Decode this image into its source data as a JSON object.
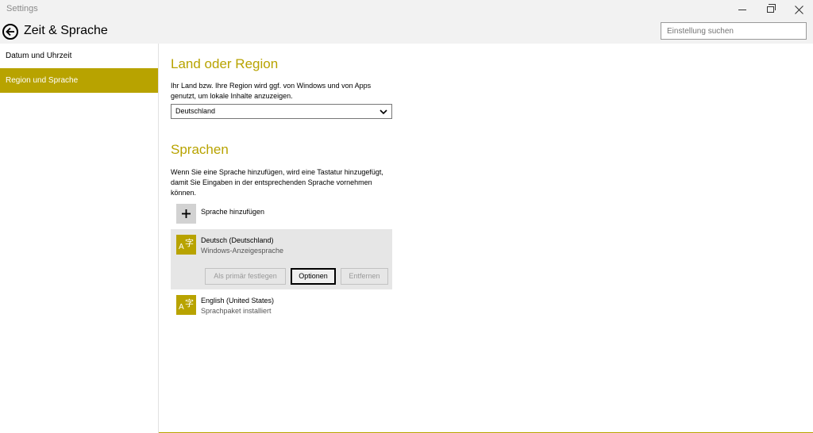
{
  "window": {
    "title": "Settings"
  },
  "header": {
    "title": "Zeit & Sprache",
    "search_placeholder": "Einstellung suchen"
  },
  "sidebar": {
    "items": [
      {
        "label": "Datum und Uhrzeit",
        "active": false
      },
      {
        "label": "Region und Sprache",
        "active": true
      }
    ]
  },
  "region": {
    "heading": "Land oder Region",
    "description": "Ihr Land bzw. Ihre Region wird ggf. von Windows und von Apps genutzt, um lokale Inhalte anzuzeigen.",
    "selected": "Deutschland"
  },
  "languages": {
    "heading": "Sprachen",
    "description": "Wenn Sie eine Sprache hinzufügen, wird eine Tastatur hinzugefügt, damit Sie Eingaben in der entsprechenden Sprache vornehmen können.",
    "add_label": "Sprache hinzufügen",
    "items": [
      {
        "name": "Deutsch (Deutschland)",
        "status": "Windows-Anzeigesprache",
        "icon": "language-icon"
      },
      {
        "name": "English (United States)",
        "status": "Sprachpaket installiert",
        "icon": "language-icon"
      }
    ],
    "buttons": {
      "set_primary": "Als primär festlegen",
      "options": "Optionen",
      "remove": "Entfernen"
    }
  },
  "colors": {
    "accent": "#b8a300",
    "card_bg": "#e6e6e6",
    "chrome_bg": "#f2f2f2"
  }
}
